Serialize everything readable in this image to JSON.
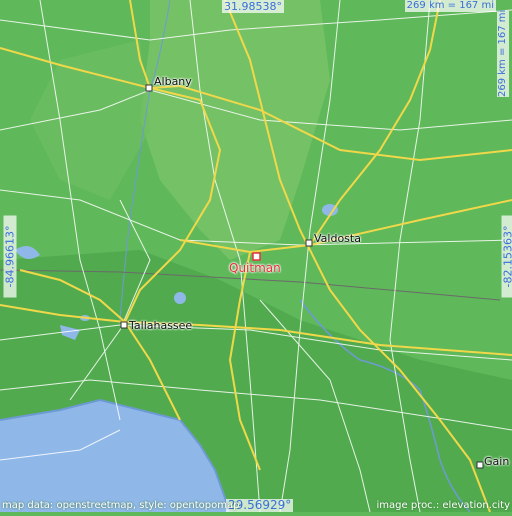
{
  "map": {
    "highlighted_city": "Quitman",
    "cities": [
      {
        "id": "albany",
        "label": "Albany"
      },
      {
        "id": "valdosta",
        "label": "Valdosta"
      },
      {
        "id": "tallahassee",
        "label": "Tallahassee"
      },
      {
        "id": "gainesville",
        "label": "Gain"
      }
    ]
  },
  "bounds": {
    "north": "31.98538°",
    "south": "29.56929°",
    "west": "-84.96613°",
    "east": "-82.15363°"
  },
  "scale": {
    "horizontal": "269 km = 167 mi",
    "vertical": "269 km = 167 mi"
  },
  "attribution": {
    "left": "map data: openstreetmap, style: opentopomap",
    "right": "image proc.: elevation.city"
  },
  "colors": {
    "land": "#5fb85a",
    "land_light": "#80c46c",
    "water": "#8fb8e8",
    "major_road": "#f0d84a",
    "minor_road": "#ffffff",
    "highlight": "#e8323d"
  }
}
